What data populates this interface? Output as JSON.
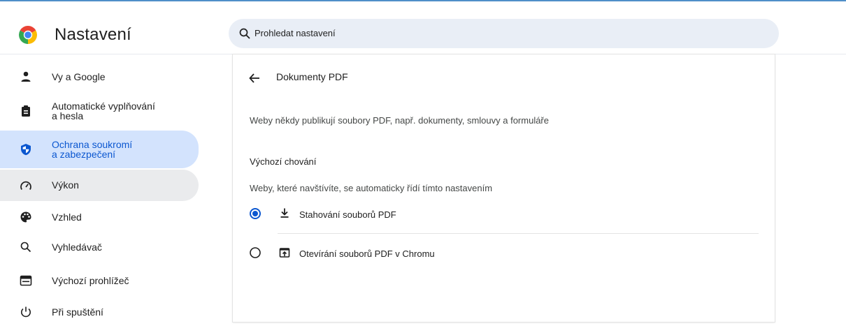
{
  "app": {
    "title": "Nastavení"
  },
  "search": {
    "placeholder": "Prohledat nastavení"
  },
  "colors": {
    "accent": "#0b57d0",
    "active_bg": "#d3e3fd",
    "search_bg": "#e9eef6"
  },
  "sidebar": {
    "items": [
      {
        "label": "Vy a Google",
        "icon": "person-icon",
        "state": "normal"
      },
      {
        "label": "Automatické vyplňování a hesla",
        "line1": "Automatické vyplňování",
        "line2": "a hesla",
        "icon": "clipboard-icon",
        "state": "normal"
      },
      {
        "label": "Ochrana soukromí a zabezpečení",
        "line1": "Ochrana soukromí",
        "line2": "a zabezpečení",
        "icon": "shield-icon",
        "state": "active"
      },
      {
        "label": "Výkon",
        "icon": "speedometer-icon",
        "state": "hover"
      },
      {
        "label": "Vzhled",
        "icon": "palette-icon",
        "state": "normal"
      },
      {
        "label": "Vyhledávač",
        "icon": "search-icon",
        "state": "normal"
      },
      {
        "label": "Výchozí prohlížeč",
        "icon": "browser-icon",
        "state": "normal"
      },
      {
        "label": "Při spuštění",
        "icon": "power-icon",
        "state": "normal"
      }
    ]
  },
  "main": {
    "title": "Dokumenty PDF",
    "description": "Weby někdy publikují soubory PDF, např. dokumenty, smlouvy a formuláře",
    "default_behavior": {
      "heading": "Výchozí chování",
      "subtitle": "Weby, které navštívíte, se automaticky řídí tímto nastavením",
      "options": [
        {
          "label": "Stahování souborů PDF",
          "icon": "download-icon",
          "selected": true
        },
        {
          "label": "Otevírání souborů PDF v Chromu",
          "icon": "open-in-browser-icon",
          "selected": false
        }
      ]
    }
  }
}
